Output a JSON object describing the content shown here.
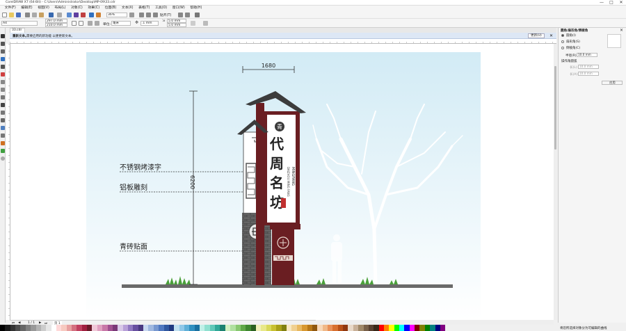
{
  "window": {
    "title": "CorelDRAW X7 (64-Bit) - C:\\Users\\Administrator\\Desktop\\MP-09\\33.cdr",
    "controls": [
      "—",
      "□",
      "✕"
    ]
  },
  "menu": [
    "文件(F)",
    "编辑(E)",
    "视图(V)",
    "布局(L)",
    "对象(C)",
    "效果(C)",
    "位图(B)",
    "文本(X)",
    "表格(T)",
    "工具(O)",
    "窗口(W)",
    "帮助(H)"
  ],
  "toolbar1": {
    "zoom": "36%",
    "snap_label": "贴齐(T)"
  },
  "toolbar2": {
    "page_size": "A4",
    "width": "297.0 mm",
    "height": "210.0 mm",
    "units_label": "单位:",
    "units": "毫米",
    "nudge": ".1 mm",
    "dup_x": "5.0 mm",
    "dup_y": "5.0 mm"
  },
  "doc_tab": "33.cdr",
  "hintbar": {
    "title": "重新文本。",
    "message": "需要启用的新功能  以便更新文本。",
    "update_button": "更新(U)",
    "cancel_icon": "✕"
  },
  "docker": {
    "title": "圆角/扇形角/倒棱角",
    "options": [
      "圆角(I)",
      "扇形角(S)",
      "倒棱角(C)"
    ],
    "radius_label": "半径(R):",
    "radius_value": "10.0 mm",
    "options_header": "操作角圆弧",
    "length1_label": "长(L):",
    "length1_value": "10.0 mm",
    "length2_label": "长(A):",
    "length2_value": "10.0 mm",
    "apply_button": "应用",
    "footer": "将您所选择对象分为可编辑的曲线"
  },
  "pagebar": {
    "page_count": "1 / 1",
    "page_name": "页 1"
  },
  "design": {
    "dimension_width": "1680",
    "dimension_height": "6200",
    "annotations": [
      "不锈钢烤漆字",
      "铝板雕刻",
      "青砖贴面"
    ],
    "sign_title": "代周名坊",
    "sign_top_char": "青",
    "pinyin": "MINGFANG",
    "small_text": "DAIZHOU MING FANG"
  },
  "palette": [
    "#000000",
    "#1a1a1a",
    "#333333",
    "#4d4d4d",
    "#666666",
    "#808080",
    "#999999",
    "#b3b3b3",
    "#cccccc",
    "#e6e6e6",
    "#ffffff",
    "#ffd9d9",
    "#f7c9c0",
    "#e8a0a0",
    "#d47080",
    "#c04060",
    "#a02040",
    "#6b1a2a",
    "#f0c8d8",
    "#e0a0c0",
    "#c878a8",
    "#a05090",
    "#7a3878",
    "#d8c8e8",
    "#b8a0d8",
    "#9078c0",
    "#6850a0",
    "#4a3880",
    "#c8d8f0",
    "#a0b8e0",
    "#7898d0",
    "#5078c0",
    "#3058a0",
    "#203880",
    "#c0e0f0",
    "#90c8e8",
    "#60b0d8",
    "#3090c0",
    "#1a70a0",
    "#c0f0e8",
    "#90e0d0",
    "#60c8b8",
    "#30a898",
    "#1a8070",
    "#d0f0c0",
    "#b0e0a0",
    "#88c870",
    "#60a848",
    "#408830",
    "#2a6020",
    "#f0f0b8",
    "#e8e888",
    "#d8d858",
    "#c8c030",
    "#a8a018",
    "#808010",
    "#f8e8c0",
    "#f0d090",
    "#e8b860",
    "#d89830",
    "#b87818",
    "#905810",
    "#f8d8b8",
    "#f0b888",
    "#e89058",
    "#d87030",
    "#b85018",
    "#903810",
    "#e8d8c8",
    "#c8b098",
    "#a08868",
    "#786048",
    "#584030",
    "#382818",
    "#ff0000",
    "#ff8000",
    "#ffff00",
    "#00ff00",
    "#00ffff",
    "#0000ff",
    "#ff00ff",
    "#800000",
    "#808000",
    "#008000",
    "#008080",
    "#000080",
    "#800080"
  ]
}
